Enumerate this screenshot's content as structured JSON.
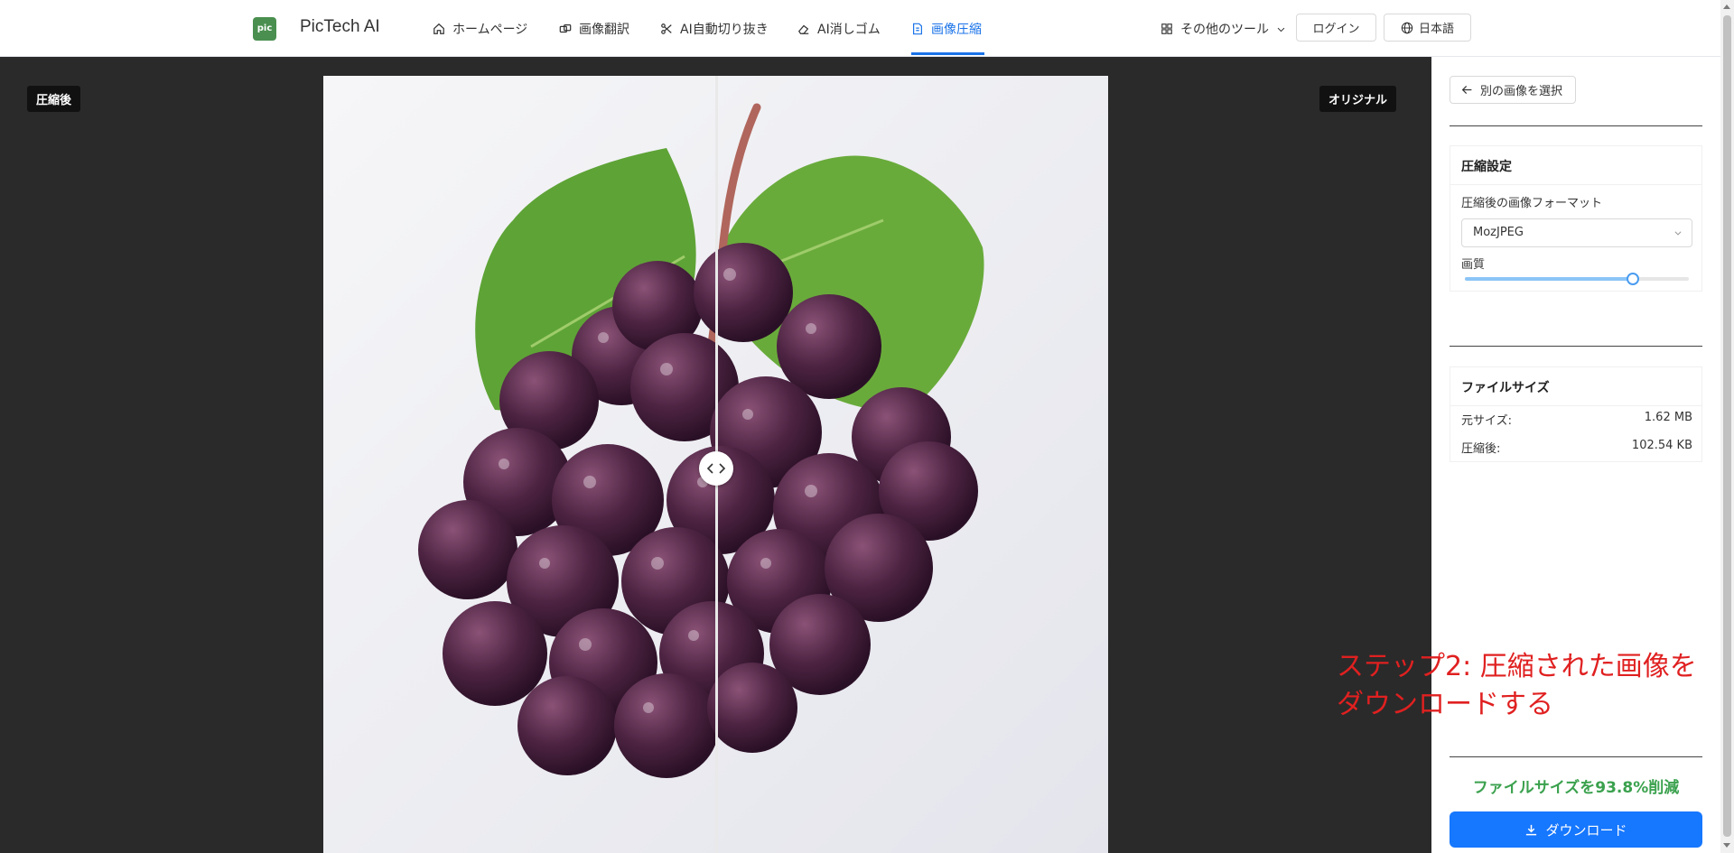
{
  "header": {
    "logo_text": "pic",
    "brand": "PicTech AI",
    "nav": [
      {
        "label": "ホームページ",
        "icon": "home-icon"
      },
      {
        "label": "画像翻訳",
        "icon": "translate-icon"
      },
      {
        "label": "AI自動切り抜き",
        "icon": "scissors-icon"
      },
      {
        "label": "AI消しゴム",
        "icon": "eraser-icon"
      },
      {
        "label": "画像圧縮",
        "icon": "file-icon",
        "active": true
      }
    ],
    "more_tools": "その他のツール",
    "login": "ログイン",
    "language": "日本語"
  },
  "viewer": {
    "left_tag": "圧縮後",
    "right_tag": "オリジナル"
  },
  "sidebar": {
    "back_button": "別の画像を選択",
    "settings": {
      "title": "圧縮設定",
      "format_label": "圧縮後の画像フォーマット",
      "format_value": "MozJPEG",
      "quality_label": "画質",
      "quality_level": 0.75
    },
    "file_size": {
      "title": "ファイルサイズ",
      "original_label": "元サイズ:",
      "original_value": "1.62 MB",
      "compressed_label": "圧縮後:",
      "compressed_value": "102.54 KB"
    },
    "savings": "ファイルサイズを93.8%削減",
    "download": "ダウンロード"
  },
  "annotation": "ステップ2: 圧縮された画像を\nダウンロードする",
  "colors": {
    "accent": "#1677ff",
    "success": "#3aa14d",
    "annotation": "#e02020",
    "viewer_bg": "#2a2a2a"
  }
}
